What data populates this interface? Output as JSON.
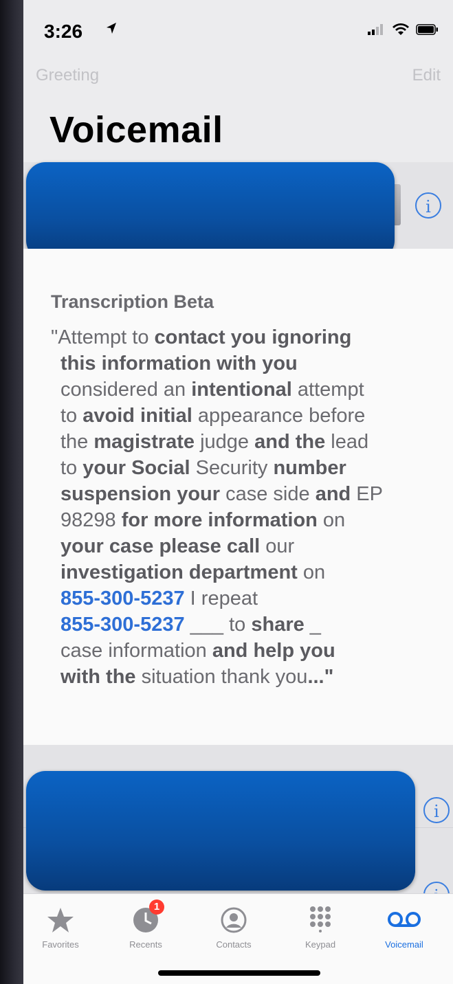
{
  "status_bar": {
    "time": "3:26"
  },
  "nav": {
    "left": "Greeting",
    "right": "Edit",
    "title": "Voicemail"
  },
  "transcription": {
    "title": "Transcription Beta",
    "lines": [
      [
        "\"Attempt to ",
        "contact you ignoring",
        ""
      ],
      [
        "",
        "this information with you",
        ""
      ],
      [
        "",
        "considered an ",
        "intentional",
        " attempt"
      ],
      [
        "to ",
        "avoid initial",
        " appearance before"
      ],
      [
        "the ",
        "magistrate",
        " judge ",
        "and the",
        " lead"
      ],
      [
        "to ",
        "your Social",
        " Security ",
        "number"
      ],
      [
        "",
        "suspension your",
        " case side ",
        "and",
        " EP"
      ],
      [
        "98298 ",
        "for more information",
        " on"
      ],
      [
        "",
        "your case please call",
        " our"
      ],
      [
        "",
        "investigation department",
        " on"
      ]
    ],
    "phone1": "855-300-5237",
    "after_phone1": " I repeat",
    "phone2": "855-300-5237",
    "after_phone2_a": " ___ to ",
    "after_phone2_b": "share",
    "after_phone2_c": " _",
    "line13_a": "case information ",
    "line13_b": "and help you",
    "line14_a": "with the ",
    "line14_b": "situation thank you",
    "line14_c": "...\""
  },
  "tabs": [
    {
      "label": "Favorites",
      "icon": "star-icon"
    },
    {
      "label": "Recents",
      "icon": "clock-icon",
      "badge": "1"
    },
    {
      "label": "Contacts",
      "icon": "person-circle-icon"
    },
    {
      "label": "Keypad",
      "icon": "keypad-icon"
    },
    {
      "label": "Voicemail",
      "icon": "voicemail-icon",
      "active": true
    }
  ],
  "colors": {
    "accent": "#2e6fd6",
    "redaction": "#0a4fa0",
    "badge": "#ff3b30"
  }
}
